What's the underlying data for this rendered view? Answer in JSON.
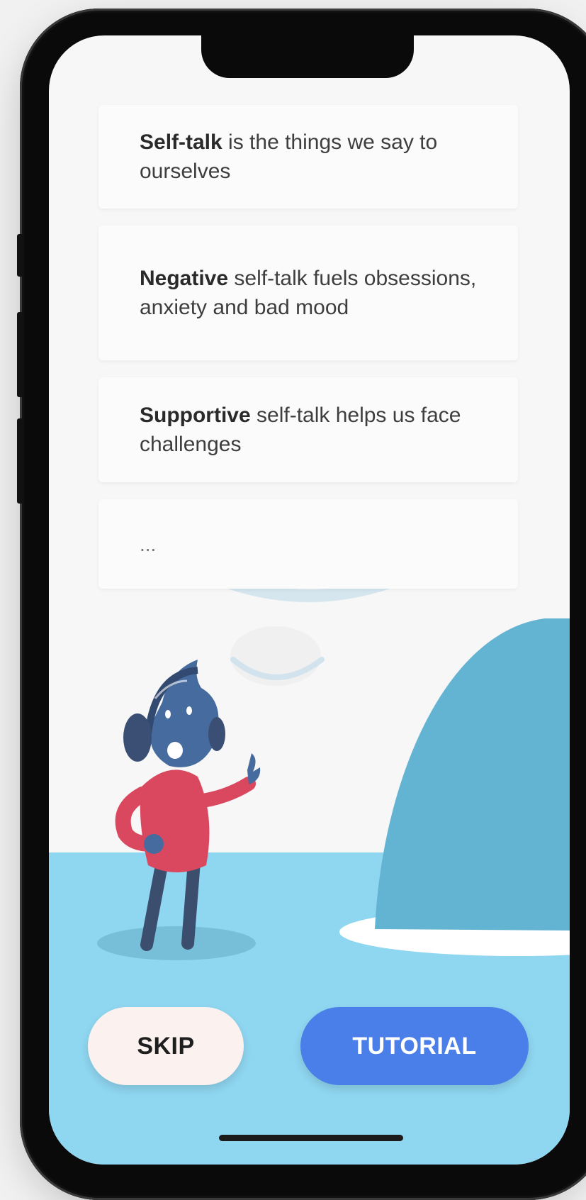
{
  "cards": [
    {
      "bold": "Self-talk",
      "rest": " is the things we say to ourselves"
    },
    {
      "bold": "Negative",
      "rest": " self-talk fuels obsessions, anxiety and bad mood"
    },
    {
      "bold": "Supportive",
      "rest": " self-talk helps us face challenges"
    },
    {
      "text": "..."
    }
  ],
  "buttons": {
    "skip_label": "SKIP",
    "tutorial_label": "TUTORIAL"
  },
  "colors": {
    "primary_button": "#4a7ee9",
    "secondary_button": "#fbf1ee",
    "floor": "#8fd6f0",
    "hill": "#63b3d3",
    "character_shirt": "#d9485f",
    "character_head": "#466b9e"
  }
}
